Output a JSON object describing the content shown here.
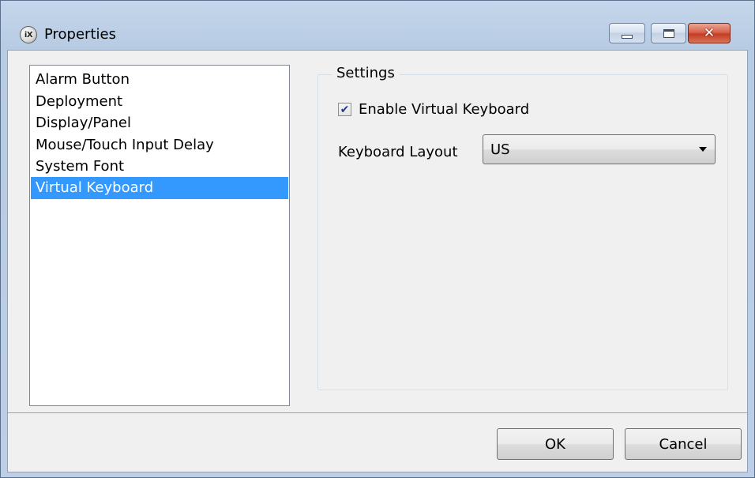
{
  "window": {
    "title": "Properties",
    "logo_text": "iX",
    "controls": {
      "minimize": "minimize",
      "maximize": "maximize",
      "close": "✕"
    }
  },
  "sidebar": {
    "items": [
      {
        "label": "Alarm Button",
        "selected": false
      },
      {
        "label": "Deployment",
        "selected": false
      },
      {
        "label": "Display/Panel",
        "selected": false
      },
      {
        "label": "Mouse/Touch Input Delay",
        "selected": false
      },
      {
        "label": "System Font",
        "selected": false
      },
      {
        "label": "Virtual Keyboard",
        "selected": true
      }
    ]
  },
  "settings": {
    "group_label": "Settings",
    "enable_virtual_keyboard": {
      "label": "Enable Virtual Keyboard",
      "checked": true
    },
    "keyboard_layout": {
      "label": "Keyboard Layout",
      "value": "US"
    }
  },
  "footer": {
    "ok_label": "OK",
    "cancel_label": "Cancel"
  },
  "colors": {
    "selection": "#3399ff",
    "titlebar": "#b9cde5",
    "close": "#c43d22"
  }
}
